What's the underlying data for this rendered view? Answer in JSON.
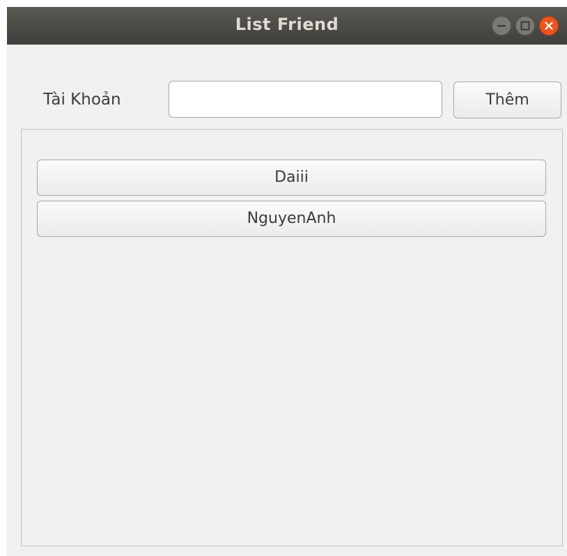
{
  "window": {
    "title": "List Friend"
  },
  "form": {
    "account_label": "Tài Khoản",
    "account_value": "",
    "add_button_label": "Thêm"
  },
  "friends": [
    {
      "name": "Daiii"
    },
    {
      "name": "NguyenAnh"
    }
  ],
  "colors": {
    "titlebar": "#4a4945",
    "close_button": "#e95420",
    "window_bg": "#f2f1f0"
  }
}
